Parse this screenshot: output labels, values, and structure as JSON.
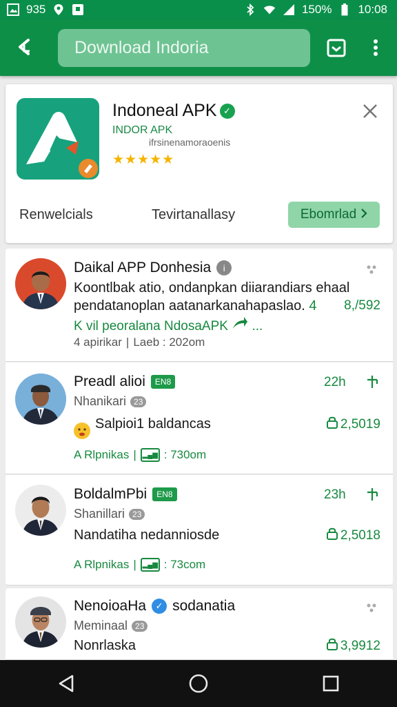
{
  "status_bar": {
    "left_text": "935",
    "battery_text": "150%",
    "time": "10:08"
  },
  "app_bar": {
    "search_value": "Download Indoria"
  },
  "app_card": {
    "title": "Indoneal APK",
    "subtitle": "INDOR APK",
    "description": "ifrsinenamoraoenis",
    "rating_stars": "★★★★★",
    "link_1": "Renwelcials",
    "link_2": "Tevirtanallasy",
    "download_label": "Ebomrlad",
    "colors": {
      "accent": "#0e8f48",
      "logo_bg": "#17a27d",
      "button_bg": "#8fd5a8"
    }
  },
  "posts": [
    {
      "name": "Daikal APP Donhesia",
      "body_line_1": "Koontlbak atio, ondanpkan diiarandiars ehaal",
      "body_line_2": "pendatanoplan aatanarkanahapaslao.",
      "body_line_2_mark": "4",
      "stat": "8,/592",
      "green_line": "K vil peoralana NdosaAPK",
      "green_suffix": "...",
      "meta_left": "4 apirikar",
      "meta_right": "Laeb : 202om"
    },
    {
      "name": "Preadl alioi",
      "badge": "EN8",
      "time": "22h",
      "handle": "Nhanikari",
      "count": "23",
      "body": "Salpioi1 baldancas",
      "stat": "2,5019",
      "meta_left": "A Rlpnikas",
      "meta_right": ": 730om"
    },
    {
      "name": "BoldalmPbi",
      "badge": "EN8",
      "time": "23h",
      "handle": "Shanillari",
      "count": "23",
      "body": "Nandatiha nedanniosde",
      "stat": "2,5018",
      "meta_left": "A Rlpnikas",
      "meta_right": ": 73com"
    },
    {
      "name": "NenoioaHa",
      "name_suffix": "sodanatia",
      "handle": "Meminaal",
      "count": "23",
      "body": "Nonrlaska",
      "stat": "3,9912"
    }
  ]
}
